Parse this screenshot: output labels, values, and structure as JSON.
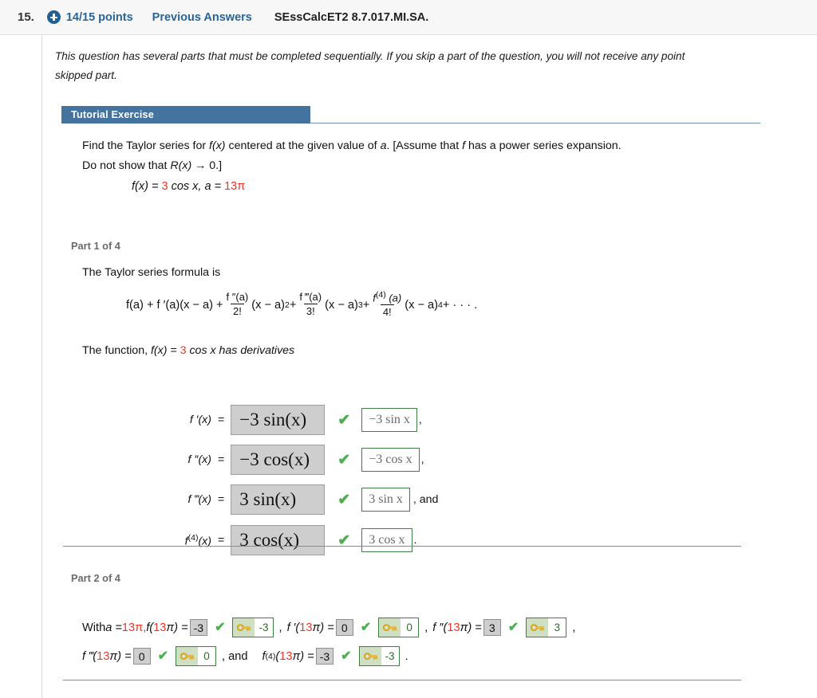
{
  "header": {
    "question_number": "15.",
    "plus_icon": "plus-circle-icon",
    "points": "14/15 points",
    "previous_answers": "Previous Answers",
    "question_code": "SEssCalcET2 8.7.017.MI.SA."
  },
  "intro": {
    "line1": "This question has several parts that must be completed sequentially. If you skip a part of the question, you will not receive any point",
    "line2": "skipped part."
  },
  "tutorial": {
    "label": "Tutorial Exercise"
  },
  "problem": {
    "line1_a": "Find the Taylor series for ",
    "line1_fx": "f(x)",
    "line1_b": " centered at the given value of ",
    "line1_a_var": "a",
    "line1_c": ". [Assume that ",
    "line1_f": "f",
    "line1_d": " has a power series expansion.",
    "line2_a": "Do not show that ",
    "line2_Rx": "R(x)",
    "line2_b": " → 0.]",
    "fx_label": "f(x) = ",
    "coefficient": "3",
    "fx_rest": " cos x, ",
    "a_label": "a = ",
    "a_coefficient": "13",
    "a_pi": "π"
  },
  "part1": {
    "label": "Part 1 of 4",
    "taylor_intro": "The Taylor series formula is",
    "formula": {
      "t1": "f(a) + f ′(a)(x − a) + ",
      "f2_num": "f ″(a)",
      "f2_den": "2!",
      "t2": "(x − a)",
      "t2_exp": "2",
      "t3": " + ",
      "f3_num": "f ‴(a)",
      "f3_den": "3!",
      "t4": "(x − a)",
      "t4_exp": "3",
      "t5": " + ",
      "f4_num_a": "f",
      "f4_num_sup": "(4)",
      "f4_num_b": " (a)",
      "f4_den": "4!",
      "t6": "(x − a)",
      "t6_exp": "4",
      "t7": " + · · · ."
    },
    "deriv_intro_a": "The function,  ",
    "deriv_intro_fx": "f(x) = ",
    "deriv_intro_coef": "3",
    "deriv_intro_b": " cos x  has derivatives",
    "derivatives": [
      {
        "label": "f ′(x)",
        "equals": "=",
        "answer": "−3 sin(x)",
        "status": "correct",
        "key_answer": "−3 sin  x",
        "trailer": ","
      },
      {
        "label": "f ″(x)",
        "equals": "=",
        "answer": "−3 cos(x)",
        "status": "correct",
        "key_answer": "−3 cos  x",
        "trailer": ","
      },
      {
        "label": "f ‴(x)",
        "equals": "=",
        "answer": "3 sin(x)",
        "status": "correct",
        "key_answer": "3 sin  x",
        "trailer": ", and"
      },
      {
        "label": "f(4)(x)",
        "label_base": "f",
        "label_sup": "(4)",
        "label_tail": "(x)",
        "equals": "=",
        "answer": "3 cos(x)",
        "status": "correct",
        "key_answer": "3 cos  x",
        "trailer": "."
      }
    ]
  },
  "part2": {
    "label": "Part 2 of 4",
    "row1": {
      "with_text": "With  ",
      "a_eq": "a = ",
      "a_val": "13",
      "a_pi": "π,  ",
      "item1": {
        "fn_a": "f(",
        "fn_red": "13",
        "fn_b": "π) = ",
        "value": "-3",
        "key_value": "-3",
        "sep": ","
      },
      "item2": {
        "fn_a": "f ′(",
        "fn_red": "13",
        "fn_b": "π) = ",
        "value": "0",
        "key_value": "0",
        "sep": ","
      },
      "item3": {
        "fn_a": "f ″(",
        "fn_red": "13",
        "fn_b": "π) = ",
        "value": "3",
        "key_value": "3",
        "sep": ","
      }
    },
    "row2": {
      "item1": {
        "fn_a": "f ‴(",
        "fn_red": "13",
        "fn_b": "π) = ",
        "value": "0",
        "key_value": "0",
        "sep": ",  and"
      },
      "item2": {
        "fn_base": "f",
        "fn_sup": "(4)",
        "fn_a": "(",
        "fn_red": "13",
        "fn_b": "π) = ",
        "value": "-3",
        "key_value": "-3",
        "sep": "."
      }
    }
  },
  "icons": {
    "check": "✔",
    "key": "key-icon"
  },
  "colors": {
    "link_blue": "#2a6496",
    "banner_blue": "#45739f",
    "red_value": "#e8362a",
    "check_green": "#4daf50",
    "key_border_green": "#3f7f3f",
    "answer_gray": "#cecece"
  }
}
